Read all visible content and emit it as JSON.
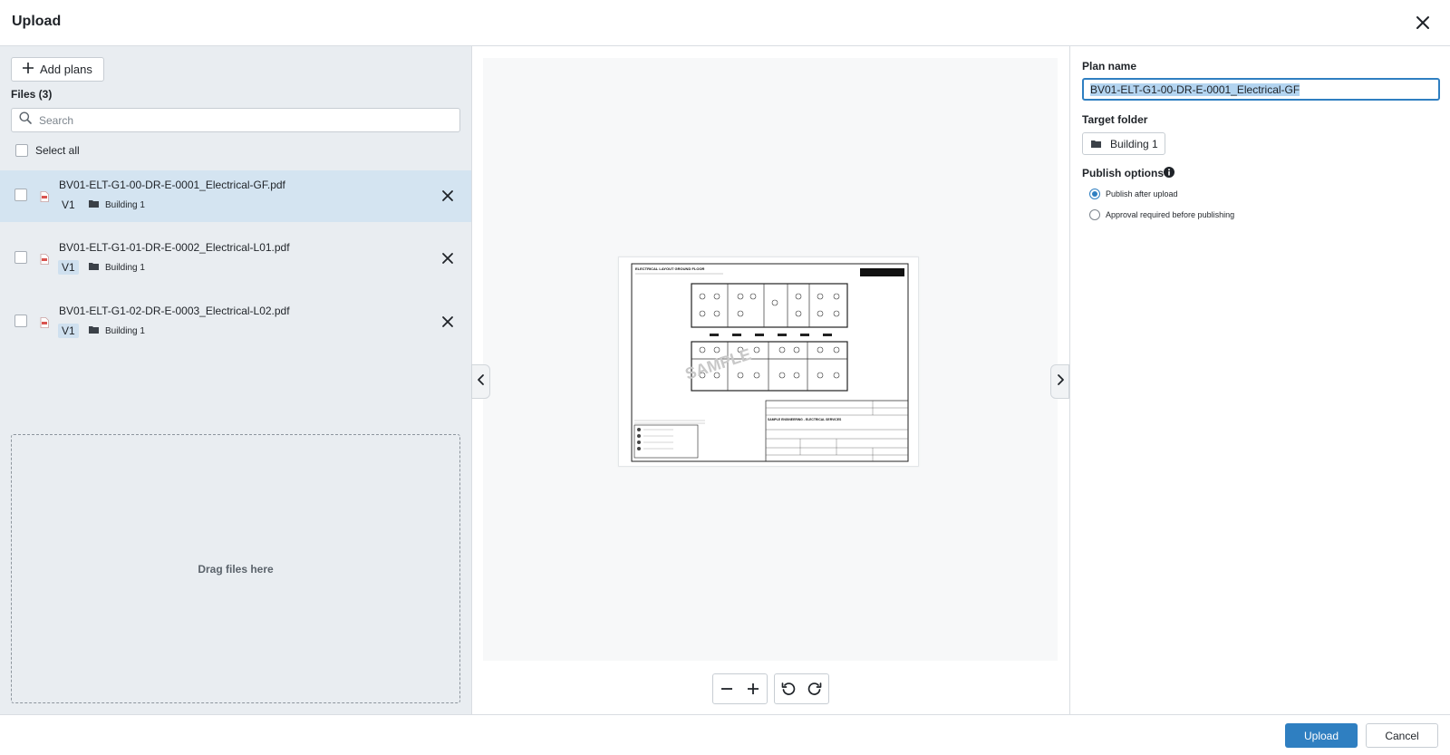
{
  "dialog": {
    "title": "Upload"
  },
  "left_panel": {
    "add_plans_label": "Add plans",
    "files_count_label": "Files (3)",
    "search_placeholder": "Search",
    "select_all_label": "Select all",
    "files": [
      {
        "name": "BV01-ELT-G1-00-DR-E-0001_Electrical-GF.pdf",
        "version": "V1",
        "folder": "Building 1",
        "selected": true
      },
      {
        "name": "BV01-ELT-G1-01-DR-E-0002_Electrical-L01.pdf",
        "version": "V1",
        "folder": "Building 1",
        "selected": false
      },
      {
        "name": "BV01-ELT-G1-02-DR-E-0003_Electrical-L02.pdf",
        "version": "V1",
        "folder": "Building 1",
        "selected": false
      }
    ],
    "dropzone_label": "Drag files here"
  },
  "preview": {
    "sheet_title": "ELECTRICAL LAYOUT GROUND FLOOR",
    "sheet_company": "SAMPLE ENGINEERING - ELECTRICAL SERVICES",
    "watermark": "SAMPLE"
  },
  "right_panel": {
    "plan_name_label": "Plan name",
    "plan_name_value": "BV01-ELT-G1-00-DR-E-0001_Electrical-GF",
    "target_folder_label": "Target folder",
    "target_folder_value": "Building 1",
    "publish_options_label": "Publish options",
    "publish_options": [
      {
        "label": "Publish after upload",
        "checked": true
      },
      {
        "label": "Approval required before publishing",
        "checked": false
      }
    ]
  },
  "footer": {
    "upload_label": "Upload",
    "cancel_label": "Cancel"
  },
  "colors": {
    "accent": "#2f7fc1",
    "selected_row": "#d4e4f1",
    "panel_bg": "#e9edf1",
    "pdf_icon": "#d9534f"
  },
  "icons": {
    "close": "close-icon",
    "add": "plus-icon",
    "search": "search-icon",
    "pdf": "pdf-file-icon",
    "folder": "folder-icon",
    "remove": "close-icon",
    "prev": "chevron-left-icon",
    "next": "chevron-right-icon",
    "zoom_out": "minus-icon",
    "zoom_in": "plus-icon",
    "rotate_left": "rotate-left-icon",
    "rotate_right": "rotate-right-icon",
    "info": "info-icon"
  }
}
